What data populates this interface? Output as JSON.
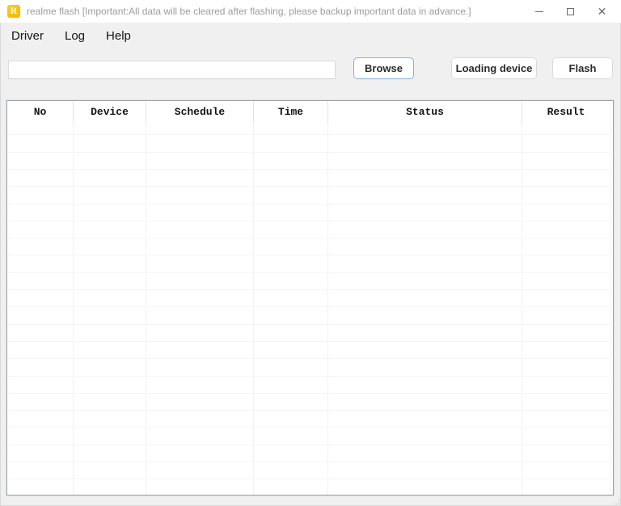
{
  "window": {
    "title": "realme flash [Important:All data will be cleared after flashing, please backup important data in advance.]",
    "icon_letter": "R",
    "icon_color": "#f7c00e",
    "controls": {
      "minimize": "minimize",
      "maximize": "maximize",
      "close": "✕"
    }
  },
  "menu": {
    "items": [
      {
        "label": "Driver"
      },
      {
        "label": "Log"
      },
      {
        "label": "Help"
      }
    ]
  },
  "toolbar": {
    "path_input": {
      "value": "",
      "placeholder": ""
    },
    "browse_label": "Browse",
    "loading_device_label": "Loading device",
    "flash_label": "Flash",
    "browse_border_color": "#7db4e0"
  },
  "table": {
    "columns": [
      {
        "label": "No"
      },
      {
        "label": "Device"
      },
      {
        "label": "Schedule"
      },
      {
        "label": "Time"
      },
      {
        "label": "Status"
      },
      {
        "label": "Result"
      }
    ],
    "rows": [],
    "empty_row_count": 22
  }
}
